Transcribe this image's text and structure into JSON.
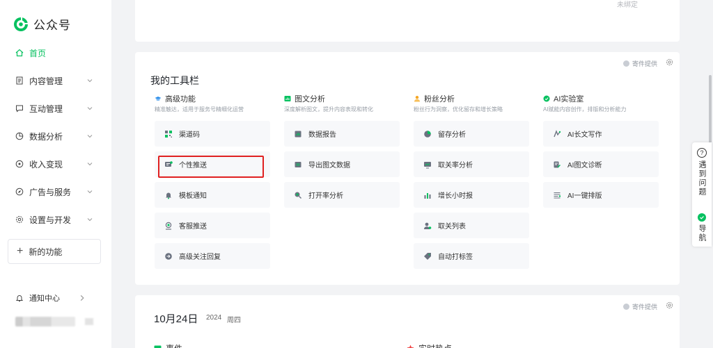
{
  "app": {
    "name": "公众号"
  },
  "sidebar": {
    "items": [
      {
        "label": "首页",
        "active": true
      },
      {
        "label": "内容管理"
      },
      {
        "label": "互动管理"
      },
      {
        "label": "数据分析"
      },
      {
        "label": "收入变现"
      },
      {
        "label": "广告与服务"
      },
      {
        "label": "设置与开发"
      }
    ],
    "new_function": "新的功能",
    "notice": "通知中心"
  },
  "top_card": {
    "status": "未绑定"
  },
  "toolbar": {
    "title": "我的工具栏",
    "vendor": "寄件提供",
    "columns": [
      {
        "title": "高级功能",
        "desc": "精准触达，适用于服务号精细化运营",
        "items": [
          "渠道码",
          "个性推送",
          "模板通知",
          "客服推送",
          "高级关注回复"
        ]
      },
      {
        "title": "图文分析",
        "desc": "深度解析图文，提升内容表现和转化",
        "items": [
          "数据报告",
          "导出图文数据",
          "打开率分析"
        ]
      },
      {
        "title": "粉丝分析",
        "desc": "粉丝行为洞察，优化留存和增长策略",
        "items": [
          "留存分析",
          "取关率分析",
          "增长小时报",
          "取关列表",
          "自动打标签"
        ]
      },
      {
        "title": "AI实验室",
        "desc": "AI赋能内容创作，排版和分析能力",
        "items": [
          "AI长文写作",
          "AI图文诊断",
          "AI一键排版"
        ]
      }
    ]
  },
  "date_card": {
    "vendor": "寄件提供",
    "date": "10月24日",
    "year": "2024",
    "weekday": "周四",
    "events_label": "事件",
    "hot_label": "实时热点"
  },
  "helper": {
    "question": "遇到问题",
    "nav": "导航"
  },
  "colors": {
    "accent": "#07c160",
    "highlight_border": "#e02020"
  }
}
